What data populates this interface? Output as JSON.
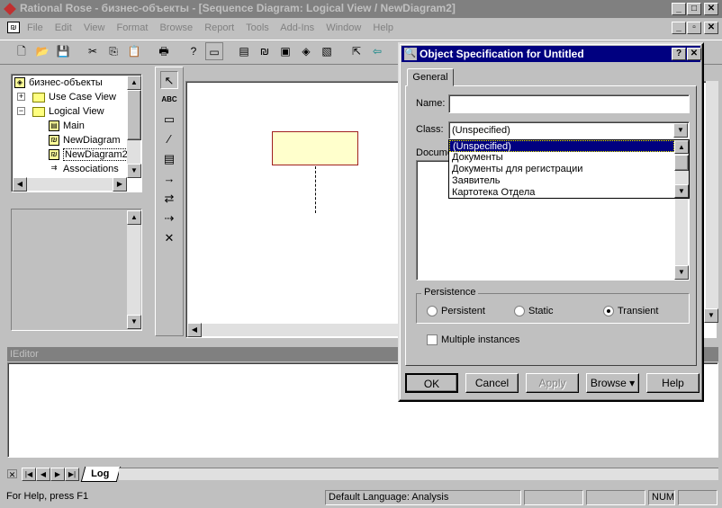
{
  "window": {
    "title": "Rational Rose - бизнес-объекты - [Sequence Diagram: Logical View / NewDiagram2]"
  },
  "menu": [
    "File",
    "Edit",
    "View",
    "Format",
    "Browse",
    "Report",
    "Tools",
    "Add-Ins",
    "Window",
    "Help"
  ],
  "browser": {
    "root": "бизнес-объекты",
    "items": [
      "Use Case View",
      "Logical View",
      "Main",
      "NewDiagram",
      "NewDiagram2",
      "Associations"
    ]
  },
  "palette": [
    "↖",
    "ABC",
    "▭",
    "⁄",
    "▤",
    "→",
    "⇄",
    "⇢",
    "✕"
  ],
  "editor": {
    "title": "IEditor"
  },
  "tabs": {
    "log": "Log"
  },
  "status": {
    "help": "For Help, press F1",
    "language": "Default Language: Analysis",
    "num": "NUM"
  },
  "dialog": {
    "title": "Object Specification for Untitled",
    "tab": "General",
    "name_label": "Name:",
    "name_value": "",
    "class_label": "Class:",
    "class_value": "(Unspecified)",
    "class_options": [
      "(Unspecified)",
      "Документы",
      "Документы для регистрации",
      "Заявитель",
      "Картотека Отдела"
    ],
    "doc_label": "Docume",
    "persistence_label": "Persistence",
    "persistence": {
      "persistent": "Persistent",
      "static": "Static",
      "transient": "Transient",
      "selected": "transient"
    },
    "multiple_label": "Multiple instances",
    "buttons": {
      "ok": "OK",
      "cancel": "Cancel",
      "apply": "Apply",
      "browse": "Browse ▾",
      "help": "Help"
    }
  }
}
